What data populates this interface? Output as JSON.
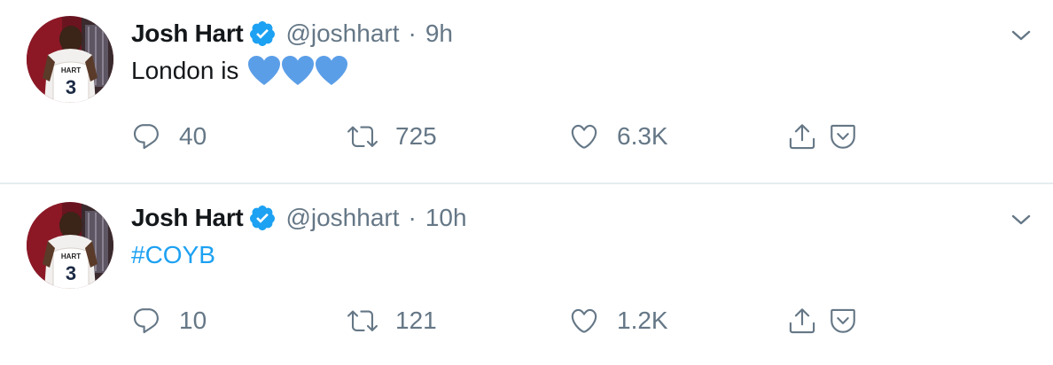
{
  "tweets": [
    {
      "author": "Josh Hart",
      "handle": "@joshhart",
      "separator": "·",
      "time": "9h",
      "text": "London is",
      "emojis": [
        "blue-heart",
        "blue-heart",
        "blue-heart"
      ],
      "replies": "40",
      "retweets": "725",
      "likes": "6.3K",
      "avatar_jersey": {
        "name": "HART",
        "number": "3"
      }
    },
    {
      "author": "Josh Hart",
      "handle": "@joshhart",
      "separator": "·",
      "time": "10h",
      "text": "#COYB",
      "replies": "10",
      "retweets": "121",
      "likes": "1.2K",
      "avatar_jersey": {
        "name": "HART",
        "number": "3"
      }
    }
  ],
  "colors": {
    "verified": "#1da1f2",
    "hashtag": "#1da1f2",
    "secondary_text": "#657786",
    "divider": "#e6ecf0",
    "heart_emoji": "#5b9ee8"
  },
  "icons": [
    "reply-icon",
    "retweet-icon",
    "like-icon",
    "share-icon",
    "save-icon",
    "chevron-down-icon",
    "verified-badge-icon"
  ]
}
